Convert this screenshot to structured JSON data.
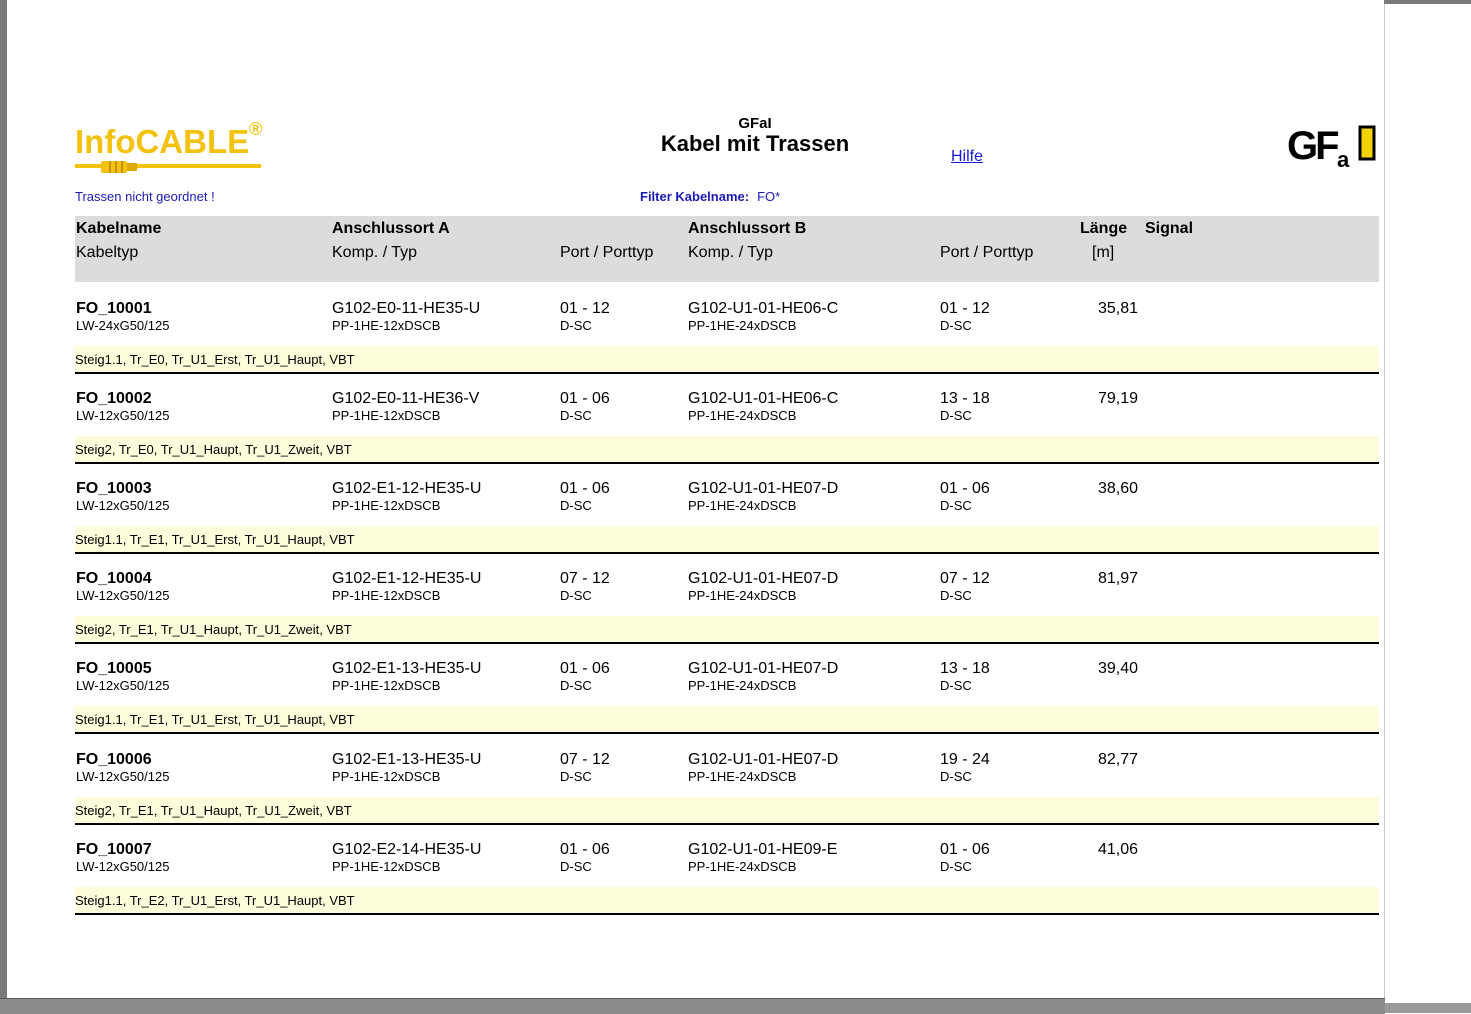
{
  "logo": {
    "name": "InfoCABLE",
    "mark": "®",
    "company_mark": "GFaI"
  },
  "header": {
    "org": "GFaI",
    "title": "Kabel mit Trassen",
    "help_link": "Hilfe",
    "sort_note": "Trassen nicht geordnet !",
    "filter_label": "Filter Kabelname:",
    "filter_value": "FO*"
  },
  "columns": {
    "kabelname": "Kabelname",
    "kabeltyp": "Kabeltyp",
    "anschlussort_a": "Anschlussort A",
    "komp_typ_a": "Komp. / Typ",
    "port_a": "Port / Porttyp",
    "anschlussort_b": "Anschlussort B",
    "komp_typ_b": "Komp. / Typ",
    "port_b": "Port / Porttyp",
    "laenge": "Länge",
    "laenge_unit": "[m]",
    "signal": "Signal"
  },
  "rows": [
    {
      "name": "FO_10001",
      "type": "LW-24xG50/125",
      "a_komp": "G102-E0-11-HE35-U",
      "a_typ": "PP-1HE-12xDSCB",
      "a_port": "01 - 12",
      "a_porttyp": "D-SC",
      "b_komp": "G102-U1-01-HE06-C",
      "b_typ": "PP-1HE-24xDSCB",
      "b_port": "01 - 12",
      "b_porttyp": "D-SC",
      "length": "35,81",
      "routes": "Steig1.1, Tr_E0, Tr_U1_Erst, Tr_U1_Haupt, VBT"
    },
    {
      "name": "FO_10002",
      "type": "LW-12xG50/125",
      "a_komp": "G102-E0-11-HE36-V",
      "a_typ": "PP-1HE-12xDSCB",
      "a_port": "01 - 06",
      "a_porttyp": "D-SC",
      "b_komp": "G102-U1-01-HE06-C",
      "b_typ": "PP-1HE-24xDSCB",
      "b_port": "13 - 18",
      "b_porttyp": "D-SC",
      "length": "79,19",
      "routes": "Steig2, Tr_E0, Tr_U1_Haupt, Tr_U1_Zweit, VBT"
    },
    {
      "name": "FO_10003",
      "type": "LW-12xG50/125",
      "a_komp": "G102-E1-12-HE35-U",
      "a_typ": "PP-1HE-12xDSCB",
      "a_port": "01 - 06",
      "a_porttyp": "D-SC",
      "b_komp": "G102-U1-01-HE07-D",
      "b_typ": "PP-1HE-24xDSCB",
      "b_port": "01 - 06",
      "b_porttyp": "D-SC",
      "length": "38,60",
      "routes": "Steig1.1, Tr_E1, Tr_U1_Erst, Tr_U1_Haupt, VBT"
    },
    {
      "name": "FO_10004",
      "type": "LW-12xG50/125",
      "a_komp": "G102-E1-12-HE35-U",
      "a_typ": "PP-1HE-12xDSCB",
      "a_port": "07 - 12",
      "a_porttyp": "D-SC",
      "b_komp": "G102-U1-01-HE07-D",
      "b_typ": "PP-1HE-24xDSCB",
      "b_port": "07 - 12",
      "b_porttyp": "D-SC",
      "length": "81,97",
      "routes": "Steig2, Tr_E1, Tr_U1_Haupt, Tr_U1_Zweit, VBT"
    },
    {
      "name": "FO_10005",
      "type": "LW-12xG50/125",
      "a_komp": "G102-E1-13-HE35-U",
      "a_typ": "PP-1HE-12xDSCB",
      "a_port": "01 - 06",
      "a_porttyp": "D-SC",
      "b_komp": "G102-U1-01-HE07-D",
      "b_typ": "PP-1HE-24xDSCB",
      "b_port": "13 - 18",
      "b_porttyp": "D-SC",
      "length": "39,40",
      "routes": "Steig1.1, Tr_E1, Tr_U1_Erst, Tr_U1_Haupt, VBT"
    },
    {
      "name": "FO_10006",
      "type": "LW-12xG50/125",
      "a_komp": "G102-E1-13-HE35-U",
      "a_typ": "PP-1HE-12xDSCB",
      "a_port": "07 - 12",
      "a_porttyp": "D-SC",
      "b_komp": "G102-U1-01-HE07-D",
      "b_typ": "PP-1HE-24xDSCB",
      "b_port": "19 - 24",
      "b_porttyp": "D-SC",
      "length": "82,77",
      "routes": "Steig2, Tr_E1, Tr_U1_Haupt, Tr_U1_Zweit, VBT"
    },
    {
      "name": "FO_10007",
      "type": "LW-12xG50/125",
      "a_komp": "G102-E2-14-HE35-U",
      "a_typ": "PP-1HE-12xDSCB",
      "a_port": "01 - 06",
      "a_porttyp": "D-SC",
      "b_komp": "G102-U1-01-HE09-E",
      "b_typ": "PP-1HE-24xDSCB",
      "b_port": "01 - 06",
      "b_porttyp": "D-SC",
      "length": "41,06",
      "routes": "Steig1.1, Tr_E2, Tr_U1_Erst, Tr_U1_Haupt, VBT"
    }
  ]
}
